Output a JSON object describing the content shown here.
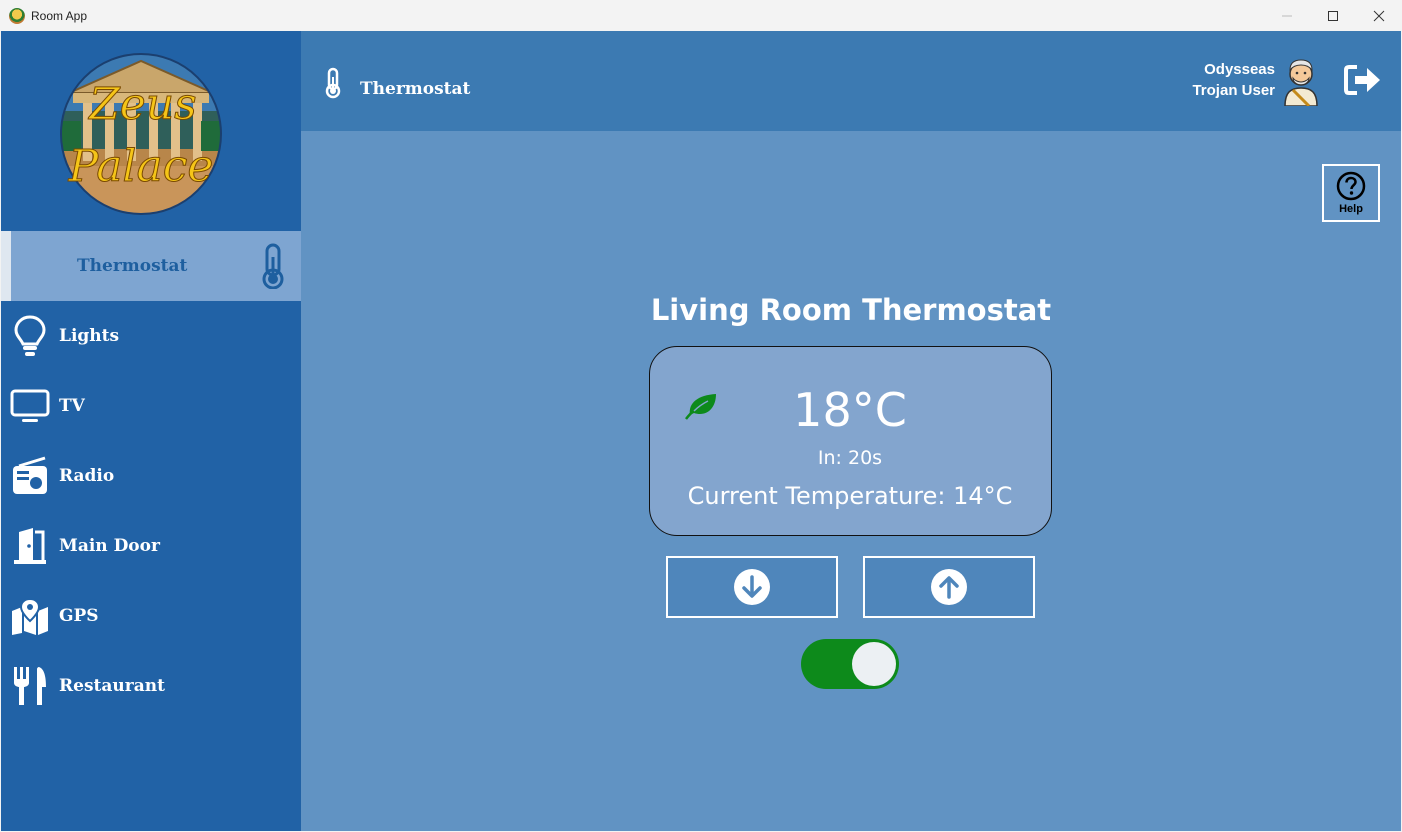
{
  "window": {
    "title": "Room App"
  },
  "sidebar": {
    "logo_alt": "Zeus Palace",
    "logo_line1": "Zeus",
    "logo_line2": "Palace",
    "items": [
      {
        "label": "Thermostat",
        "icon": "thermometer-icon",
        "active": true
      },
      {
        "label": "Lights",
        "icon": "lightbulb-icon"
      },
      {
        "label": "TV",
        "icon": "tv-icon"
      },
      {
        "label": "Radio",
        "icon": "radio-icon"
      },
      {
        "label": "Main Door",
        "icon": "door-icon"
      },
      {
        "label": "GPS",
        "icon": "map-icon"
      },
      {
        "label": "Restaurant",
        "icon": "utensils-icon"
      }
    ]
  },
  "header": {
    "title": "Thermostat",
    "icon": "thermometer-icon",
    "user_name": "Odysseas",
    "user_role": "Trojan User",
    "logout_icon": "logout-icon"
  },
  "main": {
    "help_label": "Help",
    "room_title": "Living Room Thermostat",
    "target_temp": "18°C",
    "countdown": "In: 20s",
    "current_temp": "Current Temperature: 14°C",
    "eco_icon": "leaf-icon",
    "toggle_on": true
  },
  "colors": {
    "sidebar": "#2162a6",
    "header": "#3c7ab2",
    "main": "#6193c3",
    "card": "#83a5ce",
    "toggle_on": "#0d8a1b",
    "leaf": "#0d8a1b"
  }
}
